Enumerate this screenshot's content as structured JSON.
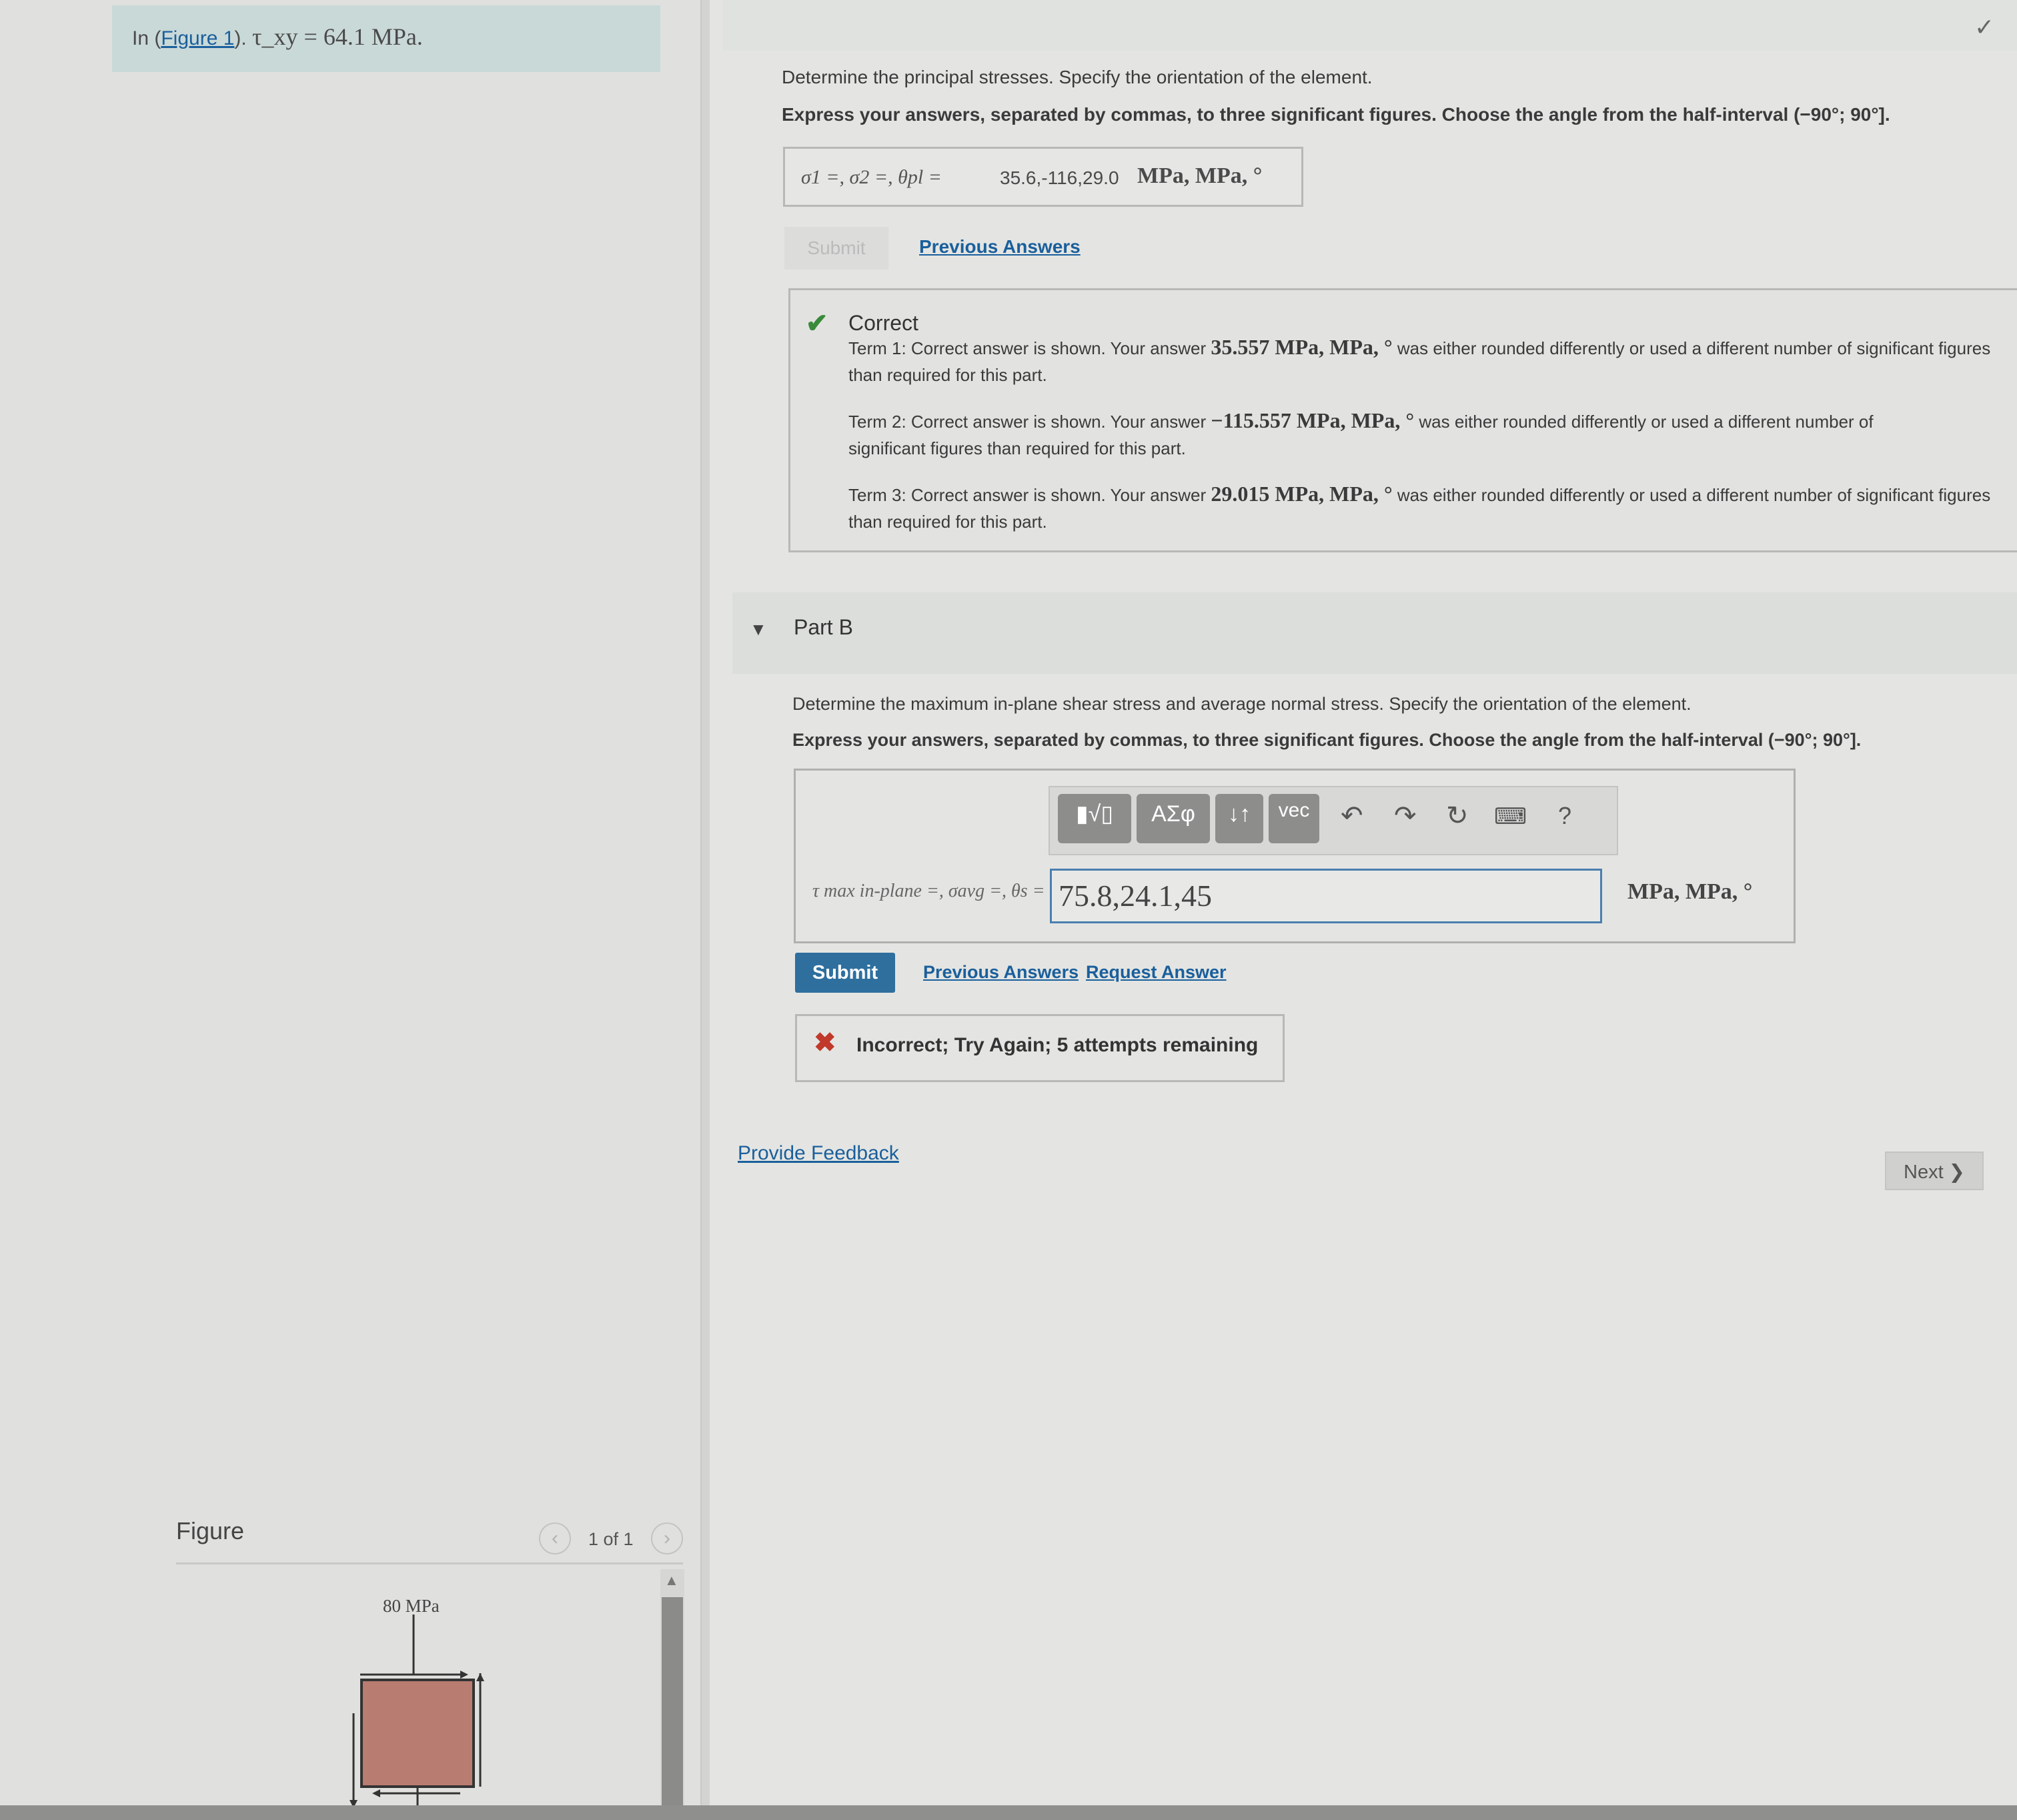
{
  "problem": {
    "prefix": "In (",
    "figure_link": "Figure 1",
    "suffix": ").",
    "given": "τ_xy = 64.1 MPa."
  },
  "part_a": {
    "question": "Determine the principal stresses. Specify the orientation of the element.",
    "instructions": "Express your answers, separated by commas, to three significant figures. Choose the angle from the half-interval (−90°; 90°].",
    "answer_label": "σ1 =, σ2 =, θpl =",
    "answer_value": "35.6,-116,29.0",
    "answer_units": "MPa, MPa, °",
    "submit_label": "Submit",
    "previous_answers_label": "Previous Answers",
    "feedback": {
      "title": "Correct",
      "terms": [
        {
          "prefix": "Term 1: Correct answer is shown. Your answer",
          "value": "35.557 MPa, MPa, °",
          "suffix": "was either rounded differently or used a different number of significant figures than required for this part."
        },
        {
          "prefix": "Term 2: Correct answer is shown. Your answer",
          "value": "−115.557 MPa, MPa, °",
          "suffix": "was either rounded differently or used a different number of significant figures than required for this part."
        },
        {
          "prefix": "Term 3: Correct answer is shown. Your answer",
          "value": "29.015 MPa, MPa, °",
          "suffix": "was either rounded differently or used a different number of significant figures than required for this part."
        }
      ]
    }
  },
  "part_b": {
    "title": "Part B",
    "question": "Determine the maximum in-plane shear stress and average normal stress. Specify the orientation of the element.",
    "instructions": "Express your answers, separated by commas, to three significant figures. Choose the angle from the half-interval (−90°; 90°].",
    "toolbar": {
      "template_btn": "▮√▯",
      "greek_btn": "ΑΣφ",
      "arrows_btn": "↓↑",
      "vec_btn": "vec",
      "help": "?"
    },
    "answer_label": "τ max in-plane =, σavg =, θs =",
    "answer_value": "75.8,24.1,45",
    "answer_units": "MPa, MPa, °",
    "submit_label": "Submit",
    "previous_answers_label": "Previous Answers",
    "request_answer_label": "Request Answer",
    "feedback": "Incorrect; Try Again; 5 attempts remaining"
  },
  "footer": {
    "provide_feedback": "Provide Feedback",
    "next_label": "Next ❯"
  },
  "figure": {
    "label": "Figure",
    "pager": "1 of 1",
    "stress_label": "80 MPa"
  }
}
